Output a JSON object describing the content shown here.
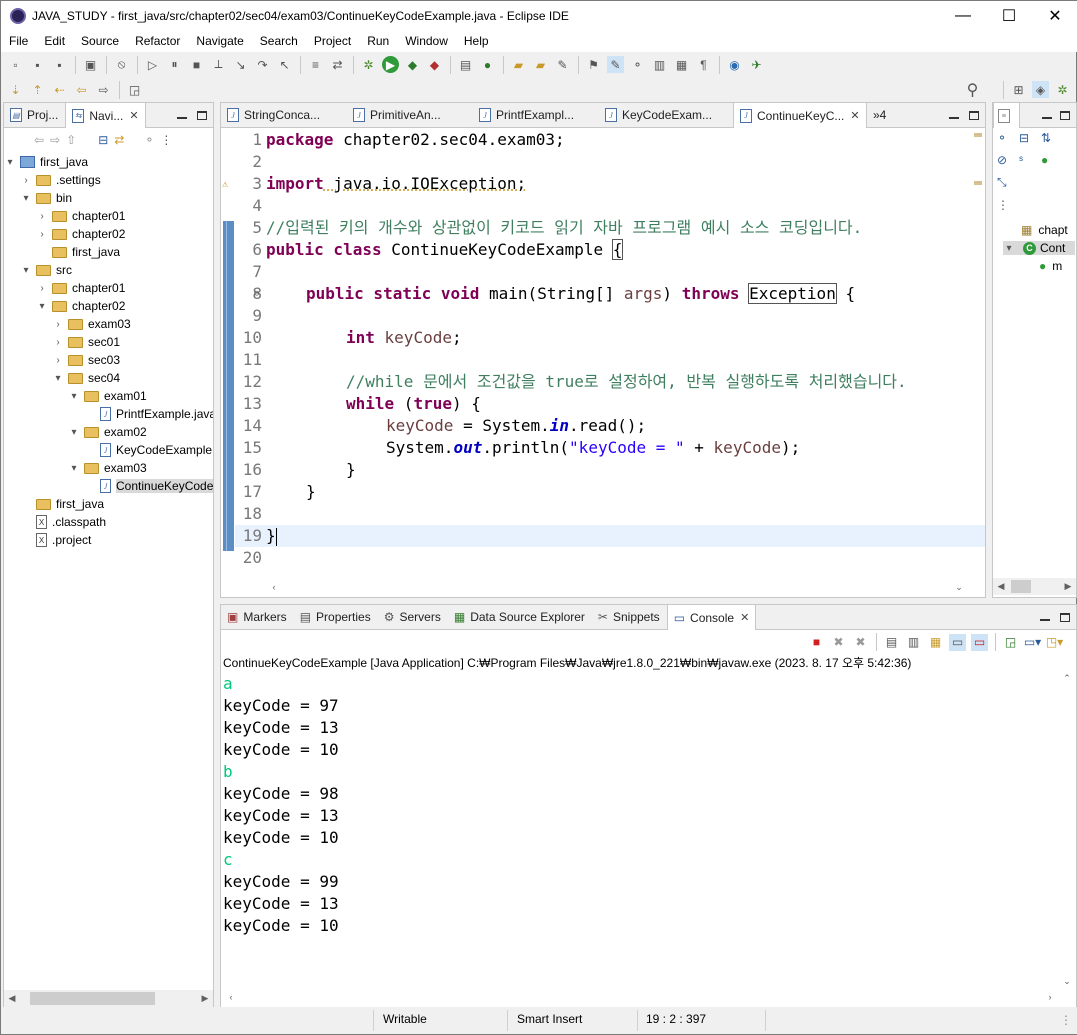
{
  "window": {
    "title": "JAVA_STUDY - first_java/src/chapter02/sec04/exam03/ContinueKeyCodeExample.java - Eclipse IDE",
    "minimize": "—",
    "maximize": "☐",
    "close": "✕"
  },
  "menu": [
    "File",
    "Edit",
    "Source",
    "Refactor",
    "Navigate",
    "Search",
    "Project",
    "Run",
    "Window",
    "Help"
  ],
  "left_tabs": [
    {
      "label": "Proj..."
    },
    {
      "label": "Navi..."
    }
  ],
  "navigator": {
    "rows": [
      {
        "label": "first_java",
        "kind": "project",
        "arrow": "▾",
        "depth": 0
      },
      {
        "label": ".settings",
        "kind": "folder",
        "arrow": "›",
        "depth": 1
      },
      {
        "label": "bin",
        "kind": "folder",
        "arrow": "▾",
        "depth": 1
      },
      {
        "label": "chapter01",
        "kind": "folder",
        "arrow": "›",
        "depth": 2
      },
      {
        "label": "chapter02",
        "kind": "folder",
        "arrow": "›",
        "depth": 2
      },
      {
        "label": "first_java",
        "kind": "folder",
        "arrow": "",
        "depth": 2
      },
      {
        "label": "src",
        "kind": "folder",
        "arrow": "▾",
        "depth": 1
      },
      {
        "label": "chapter01",
        "kind": "folder",
        "arrow": "›",
        "depth": 2
      },
      {
        "label": "chapter02",
        "kind": "folder",
        "arrow": "▾",
        "depth": 2
      },
      {
        "label": "exam03",
        "kind": "folder",
        "arrow": "›",
        "depth": 3
      },
      {
        "label": "sec01",
        "kind": "folder",
        "arrow": "›",
        "depth": 3
      },
      {
        "label": "sec03",
        "kind": "folder",
        "arrow": "›",
        "depth": 3
      },
      {
        "label": "sec04",
        "kind": "folder",
        "arrow": "▾",
        "depth": 3
      },
      {
        "label": "exam01",
        "kind": "folder",
        "arrow": "▾",
        "depth": 4
      },
      {
        "label": "PrintfExample.java",
        "kind": "java",
        "arrow": "",
        "depth": 5
      },
      {
        "label": "exam02",
        "kind": "folder",
        "arrow": "▾",
        "depth": 4
      },
      {
        "label": "KeyCodeExample.ja",
        "kind": "java",
        "arrow": "",
        "depth": 5
      },
      {
        "label": "exam03",
        "kind": "folder",
        "arrow": "▾",
        "depth": 4
      },
      {
        "label": "ContinueKeyCodeE",
        "kind": "java",
        "arrow": "",
        "depth": 5,
        "selected": true
      },
      {
        "label": "first_java",
        "kind": "folder",
        "arrow": "",
        "depth": 1
      },
      {
        "label": ".classpath",
        "kind": "xml",
        "arrow": "",
        "depth": 1
      },
      {
        "label": ".project",
        "kind": "xml",
        "arrow": "",
        "depth": 1
      }
    ]
  },
  "editor_tabs": [
    {
      "label": "StringConca..."
    },
    {
      "label": "PrimitiveAn..."
    },
    {
      "label": "PrintfExampl..."
    },
    {
      "label": "KeyCodeExam..."
    },
    {
      "label": "ContinueKeyC...",
      "active": true
    }
  ],
  "editor_overflow": "»4",
  "code": {
    "line_numbers": [
      "1",
      "2",
      "3",
      "4",
      "5",
      "6",
      "7",
      "8",
      "9",
      "10",
      "11",
      "12",
      "13",
      "14",
      "15",
      "16",
      "17",
      "18",
      "19",
      "20"
    ],
    "l1_kw": "package",
    "l1_rest": " chapter02.sec04.exam03;",
    "l3_kw": "import",
    "l3_rest": " java.io.IOException;",
    "l5": "//입력된 키의 개수와 상관없이 키코드 읽기 자바 프로그램 예시 소스 코딩입니다.",
    "l6_kw": "public class",
    "l6_name": " ContinueKeyCodeExample ",
    "l6_brace": "{",
    "l8_kw": "public static void",
    "l8_a": " main(String[] ",
    "l8_args": "args",
    "l8_b": ") ",
    "l8_throws": "throws",
    "l8_sp": " ",
    "l8_exc": "Exception",
    "l8_c": " {",
    "l10_kw": "int",
    "l10_var": " keyCode",
    "l10_rest": ";",
    "l12": "//while 문에서 조건값을 true로 설정하여, 반복 실행하도록 처리했습니다.",
    "l13_kw": "while",
    "l13_a": " (",
    "l13_true": "true",
    "l13_b": ") {",
    "l14_var": "keyCode",
    "l14_a": " = System.",
    "l14_in": "in",
    "l14_b": ".read();",
    "l15_a": "System.",
    "l15_out": "out",
    "l15_b": ".println(",
    "l15_str": "\"keyCode = \"",
    "l15_c": " + ",
    "l15_var": "keyCode",
    "l15_d": ");",
    "l16": "}",
    "l17": "}",
    "l19": "}"
  },
  "outline": {
    "items": [
      "chapt",
      "Cont",
      "m"
    ]
  },
  "bottom_tabs": [
    {
      "label": "Markers"
    },
    {
      "label": "Properties"
    },
    {
      "label": "Servers"
    },
    {
      "label": "Data Source Explorer"
    },
    {
      "label": "Snippets"
    },
    {
      "label": "Console",
      "active": true
    }
  ],
  "console": {
    "description": "ContinueKeyCodeExample [Java Application] C:₩Program Files₩Java₩jre1.8.0_221₩bin₩javaw.exe  (2023. 8. 17 오후 5:42:36)",
    "lines": [
      {
        "text": "a",
        "input": true
      },
      {
        "text": "keyCode = 97"
      },
      {
        "text": "keyCode = 13"
      },
      {
        "text": "keyCode = 10"
      },
      {
        "text": "b",
        "input": true
      },
      {
        "text": "keyCode = 98"
      },
      {
        "text": "keyCode = 13"
      },
      {
        "text": "keyCode = 10"
      },
      {
        "text": "c",
        "input": true
      },
      {
        "text": "keyCode = 99"
      },
      {
        "text": "keyCode = 13"
      },
      {
        "text": "keyCode = 10"
      }
    ]
  },
  "status": {
    "writable": "Writable",
    "insert_mode": "Smart Insert",
    "position": "19 : 2 : 397"
  },
  "colors": {
    "keyword": "#7f0055",
    "comment": "#3f7f5f",
    "string": "#2a00ff",
    "console_input": "#00c87d"
  }
}
